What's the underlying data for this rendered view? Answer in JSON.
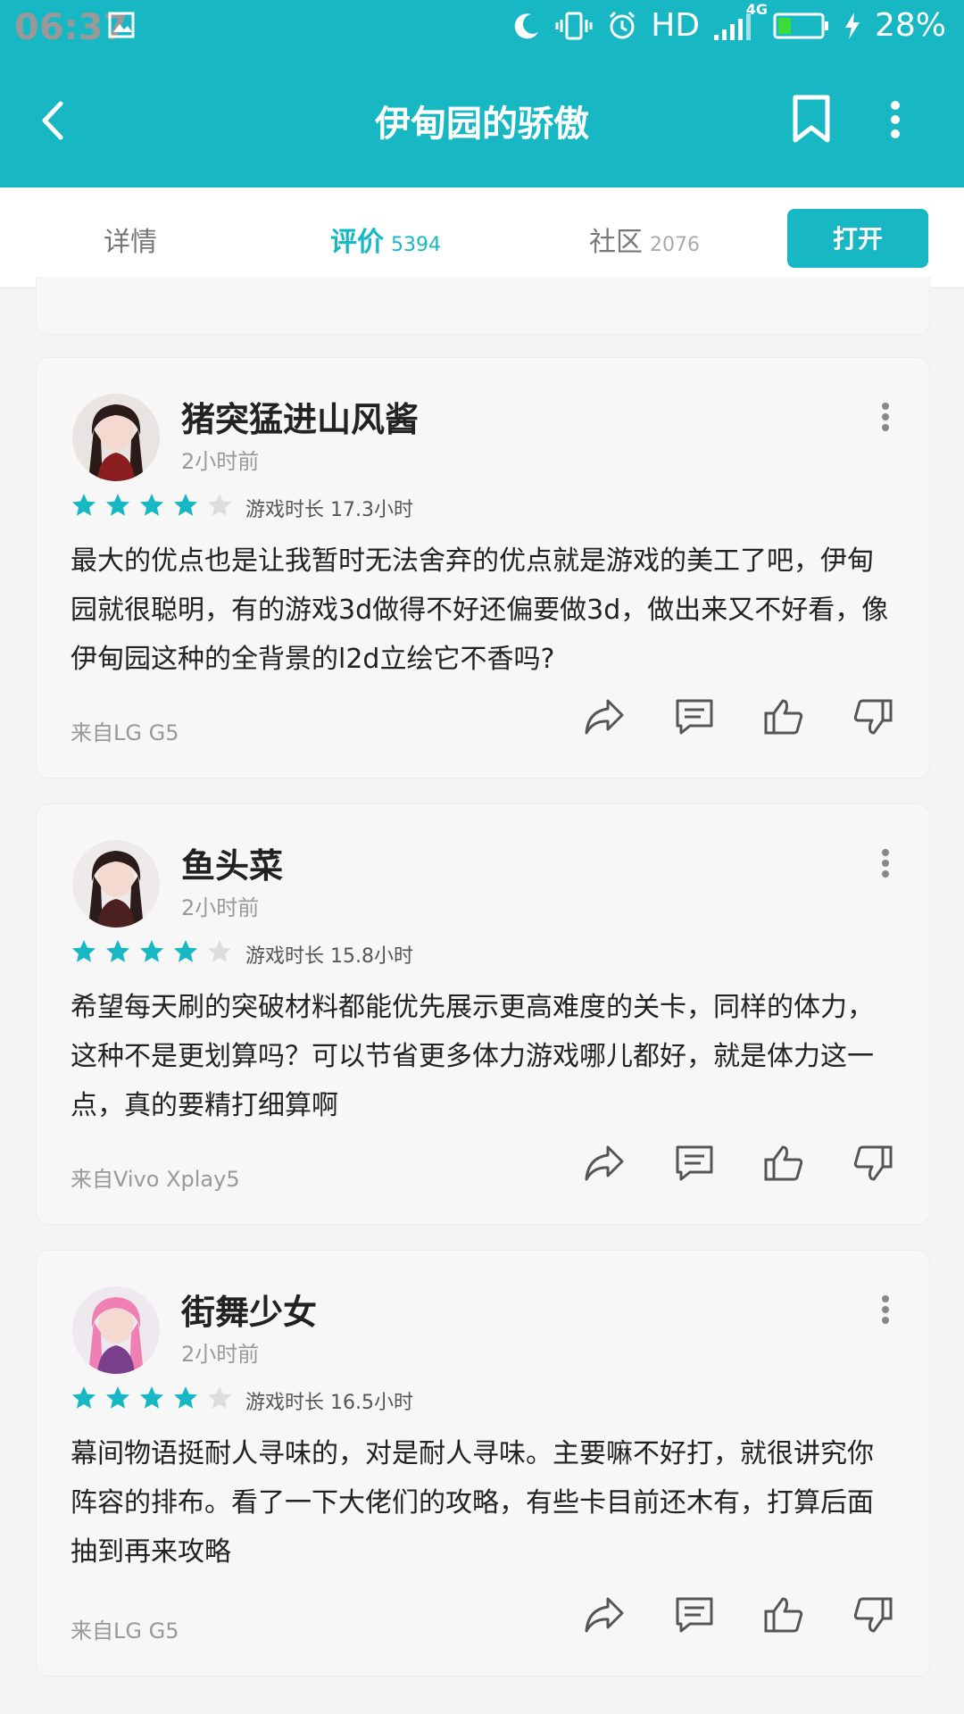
{
  "status_bar": {
    "time": "06:37",
    "hd": "HD",
    "network": "4G",
    "battery": "28%",
    "icons": [
      "gallery-icon",
      "moon-icon",
      "vibrate-icon",
      "alarm-icon",
      "signal-icon",
      "battery-icon",
      "charging-icon"
    ]
  },
  "app_bar": {
    "title": "伊甸园的骄傲",
    "icons": [
      "back-icon",
      "bookmark-icon",
      "more-vertical-icon"
    ]
  },
  "tabs": [
    {
      "label": "详情",
      "count": ""
    },
    {
      "label": "评价",
      "count": "5394"
    },
    {
      "label": "社区",
      "count": "2076"
    }
  ],
  "open_button": "打开",
  "reviews": [
    {
      "username": "猪突猛进山风酱",
      "time": "2小时前",
      "rating": 4,
      "playtime": "游戏时长 17.3小时",
      "text": "最大的优点也是让我暂时无法舍弃的优点就是游戏的美工了吧，伊甸园就很聪明，有的游戏3d做得不好还偏要做3d，做出来又不好看，像伊甸园这种的全背景的l2d立绘它不香吗?",
      "device": "来自LG G5"
    },
    {
      "username": "鱼头菜",
      "time": "2小时前",
      "rating": 4,
      "playtime": "游戏时长 15.8小时",
      "text": "希望每天刷的突破材料都能优先展示更高难度的关卡，同样的体力，这种不是更划算吗？可以节省更多体力游戏哪儿都好，就是体力这一点，真的要精打细算啊",
      "device": "来自Vivo Xplay5"
    },
    {
      "username": "街舞少女",
      "time": "2小时前",
      "rating": 4,
      "playtime": "游戏时长 16.5小时",
      "text": "幕间物语挺耐人寻味的，对是耐人寻味。主要嘛不好打，就很讲究你阵容的排布。看了一下大佬们的攻略，有些卡目前还木有，打算后面抽到再来攻略",
      "device": "来自LG G5"
    }
  ],
  "colors": {
    "accent": "#17b7c3",
    "star_on": "#17b7c3",
    "star_off": "#dddddd"
  }
}
